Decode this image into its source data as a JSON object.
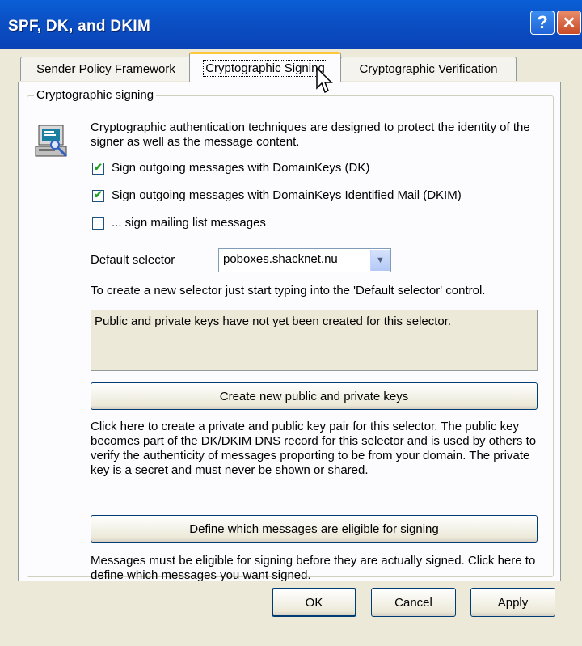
{
  "window": {
    "title": "SPF, DK, and DKIM"
  },
  "tabs": [
    {
      "label": "Sender Policy Framework",
      "active": false
    },
    {
      "label": "Cryptographic Signing",
      "active": true
    },
    {
      "label": "Cryptographic Verification",
      "active": false
    }
  ],
  "group": {
    "label": "Cryptographic signing"
  },
  "intro": "Cryptographic authentication techniques are designed to protect the identity of the signer as well as the message content.",
  "checkboxes": [
    {
      "label": "Sign outgoing messages with DomainKeys (DK)",
      "checked": true
    },
    {
      "label": "Sign outgoing messages with DomainKeys Identified Mail (DKIM)",
      "checked": true
    },
    {
      "label": "... sign mailing list messages",
      "checked": false
    }
  ],
  "selector": {
    "label": "Default selector",
    "value": "poboxes.shacknet.nu",
    "hint": "To create a new selector just start typing into the 'Default selector' control."
  },
  "key_status": "Public and private keys have not yet been created for this selector.",
  "create_keys": {
    "label": "Create new public and private keys",
    "description": "Click here to create a private and public key pair for this selector.  The public key becomes part of the DK/DKIM DNS record for this selector and is used by others to verify the authenticity of messages proporting to be from your domain.  The private key is a secret and must never be shown or shared."
  },
  "eligible": {
    "label": "Define which messages are eligible for signing",
    "description": "Messages must be eligible for signing before they are actually signed.  Click here to define which messages you want signed."
  },
  "buttons": {
    "ok": "OK",
    "cancel": "Cancel",
    "apply": "Apply"
  }
}
